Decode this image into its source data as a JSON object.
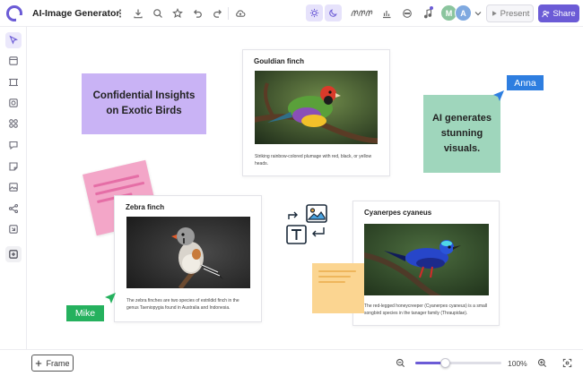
{
  "app": {
    "title": "AI-Image Generator"
  },
  "header": {
    "collaborators": [
      {
        "initial": "M",
        "color": "#8bc59e"
      },
      {
        "initial": "A",
        "color": "#7fa9e0"
      }
    ],
    "present_label": "Present",
    "share_label": "Share"
  },
  "left_toolbar": {
    "tools": [
      "pointer-icon",
      "frame-icon",
      "template-icon",
      "shapes-icon",
      "components-icon",
      "comment-icon",
      "sticky-note-icon",
      "image-icon",
      "connector-icon",
      "embed-icon",
      "add-icon"
    ]
  },
  "canvas": {
    "sticky_purple": {
      "text": "Confidential Insights on Exotic Birds",
      "color": "#c9b3f5"
    },
    "sticky_green": {
      "text": "AI generates stunning visuals.",
      "color": "#9fd6bc"
    },
    "cards": {
      "gouldian": {
        "title": "Gouldian finch",
        "description": "Striking rainbow-colored plumage with red, black, or yellow heads."
      },
      "zebra": {
        "title": "Zebra finch",
        "description": "The zebra finches are two species of estrildid finch in the genus Taeniopygia found in Australia and Indonesia."
      },
      "cyanerpes": {
        "title": "Cyanerpes cyaneus",
        "description": "The red-legged honeycreeper (Cyanerpes cyaneus) is a small songbird species in the tanager family (Thraupidae)."
      }
    },
    "cursors": {
      "anna": {
        "name": "Anna",
        "color": "#2e7ee0"
      },
      "mike": {
        "name": "Mike",
        "color": "#25b15e"
      }
    }
  },
  "bottom_bar": {
    "frame_label": "Frame",
    "zoom_label": "100%",
    "zoom_fraction": 0.35
  }
}
